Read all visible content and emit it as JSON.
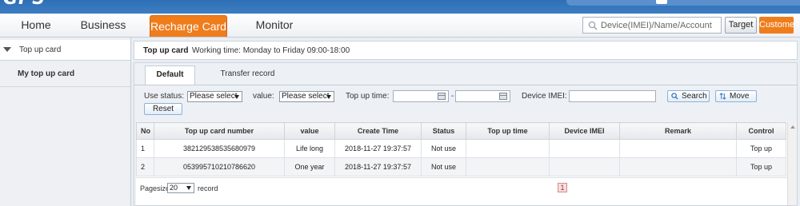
{
  "nav": {
    "items": [
      {
        "label": "Home"
      },
      {
        "label": "Business"
      },
      {
        "label": "Recharge Card"
      },
      {
        "label": "Monitor"
      }
    ],
    "active_index": 2,
    "search_placeholder": "Device(IMEI)/Name/Account",
    "target_label": "Target",
    "customer_label": "Customer"
  },
  "sidebar": {
    "group_label": "Top up card",
    "items": [
      {
        "label": "My top up card"
      }
    ]
  },
  "main": {
    "title": "Top up card",
    "working_time": "Working time: Monday to Friday 09:00-18:00",
    "tabs": [
      {
        "label": "Default"
      },
      {
        "label": "Transfer record"
      }
    ],
    "active_tab": 0
  },
  "filters": {
    "use_status_label": "Use status:",
    "use_status_value": "Please select",
    "value_label": "value:",
    "value_value": "Please select",
    "top_up_time_label": "Top up time:",
    "date_sep": "-",
    "device_imei_label": "Device IMEI:",
    "search_label": "Search",
    "move_label": "Move",
    "reset_label": "Reset"
  },
  "table": {
    "headers": [
      "No",
      "Top up card number",
      "value",
      "Create Time",
      "Status",
      "Top up time",
      "Device IMEI",
      "Remark",
      "Control"
    ],
    "rows": [
      [
        "1",
        "382129538535680979",
        "Life long",
        "2018-11-27 19:37:57",
        "Not use",
        "",
        "",
        "",
        "Top up"
      ],
      [
        "2",
        "053995710210786620",
        "One year",
        "2018-11-27 19:37:57",
        "Not use",
        "",
        "",
        "",
        "Top up"
      ]
    ]
  },
  "pagination": {
    "pagesize_label": "Pagesize",
    "pagesize_value": "20",
    "record_label": "record",
    "current_page": "1"
  },
  "colors": {
    "accent": "#ef7d1c",
    "brand_blue": "#2f6fb5"
  }
}
